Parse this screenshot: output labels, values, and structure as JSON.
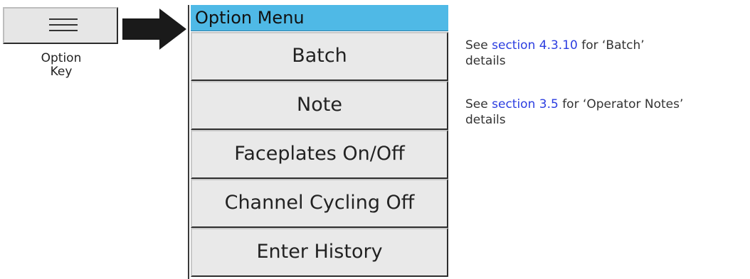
{
  "option_key": {
    "caption_line1": "Option",
    "caption_line2": "Key"
  },
  "menu": {
    "title": "Option Menu",
    "items": [
      {
        "label": "Batch"
      },
      {
        "label": "Note"
      },
      {
        "label": "Faceplates On/Off"
      },
      {
        "label": "Channel Cycling Off"
      },
      {
        "label": "Enter History"
      }
    ]
  },
  "notes": [
    {
      "prefix": "See ",
      "link": "section 4.3.10",
      "suffix": " for ‘Batch’",
      "line2": "details"
    },
    {
      "prefix": "See ",
      "link": "section 3.5",
      "suffix": " for ‘Operator Notes’",
      "line2": "details"
    }
  ],
  "colors": {
    "title_bar": "#4fb9e6",
    "link": "#2b3de0",
    "button_face": "#e9e9e9"
  }
}
